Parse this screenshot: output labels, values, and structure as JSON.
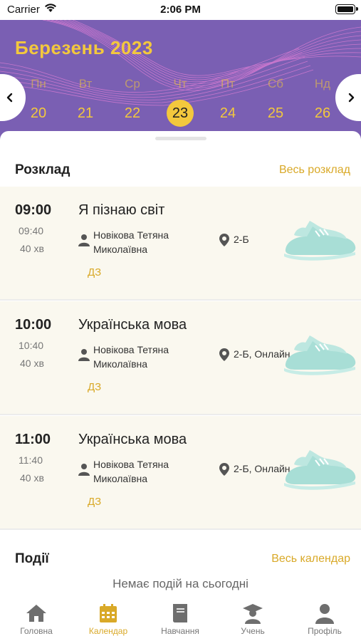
{
  "status_bar": {
    "carrier": "Carrier",
    "time": "2:06 PM"
  },
  "calendar": {
    "month": "Березень 2023",
    "day_names": [
      "Пн",
      "Вт",
      "Ср",
      "Чт",
      "Пт",
      "Сб",
      "Нд"
    ],
    "days": [
      "20",
      "21",
      "22",
      "23",
      "24",
      "25",
      "26"
    ],
    "selected_day": "23",
    "colors": {
      "header_bg": "#7a5fb3",
      "accent": "#f3c83d"
    }
  },
  "schedule": {
    "title": "Розклад",
    "all_link": "Весь розклад",
    "lessons": [
      {
        "start": "09:00",
        "end": "09:40",
        "duration": "40 хв",
        "subject": "Я пізнаю світ",
        "teacher": "Новікова Тетяна Миколаївна",
        "room": "2-Б",
        "homework": "ДЗ"
      },
      {
        "start": "10:00",
        "end": "10:40",
        "duration": "40 хв",
        "subject": "Українська мова",
        "teacher": "Новікова Тетяна Миколаївна",
        "room": "2-Б, Онлайн",
        "homework": "ДЗ"
      },
      {
        "start": "11:00",
        "end": "11:40",
        "duration": "40 хв",
        "subject": "Українська мова",
        "teacher": "Новікова Тетяна Миколаївна",
        "room": "2-Б, Онлайн",
        "homework": "ДЗ"
      }
    ]
  },
  "events": {
    "title": "Події",
    "all_link": "Весь календар",
    "empty_text": "Немає подій на сьогодні"
  },
  "tabbar": {
    "active": "calendar",
    "items": [
      {
        "id": "home",
        "label": "Головна",
        "icon": "home-icon"
      },
      {
        "id": "calendar",
        "label": "Календар",
        "icon": "calendar-icon"
      },
      {
        "id": "learning",
        "label": "Навчання",
        "icon": "book-icon"
      },
      {
        "id": "student",
        "label": "Учень",
        "icon": "student-icon"
      },
      {
        "id": "profile",
        "label": "Профіль",
        "icon": "profile-icon"
      }
    ]
  }
}
